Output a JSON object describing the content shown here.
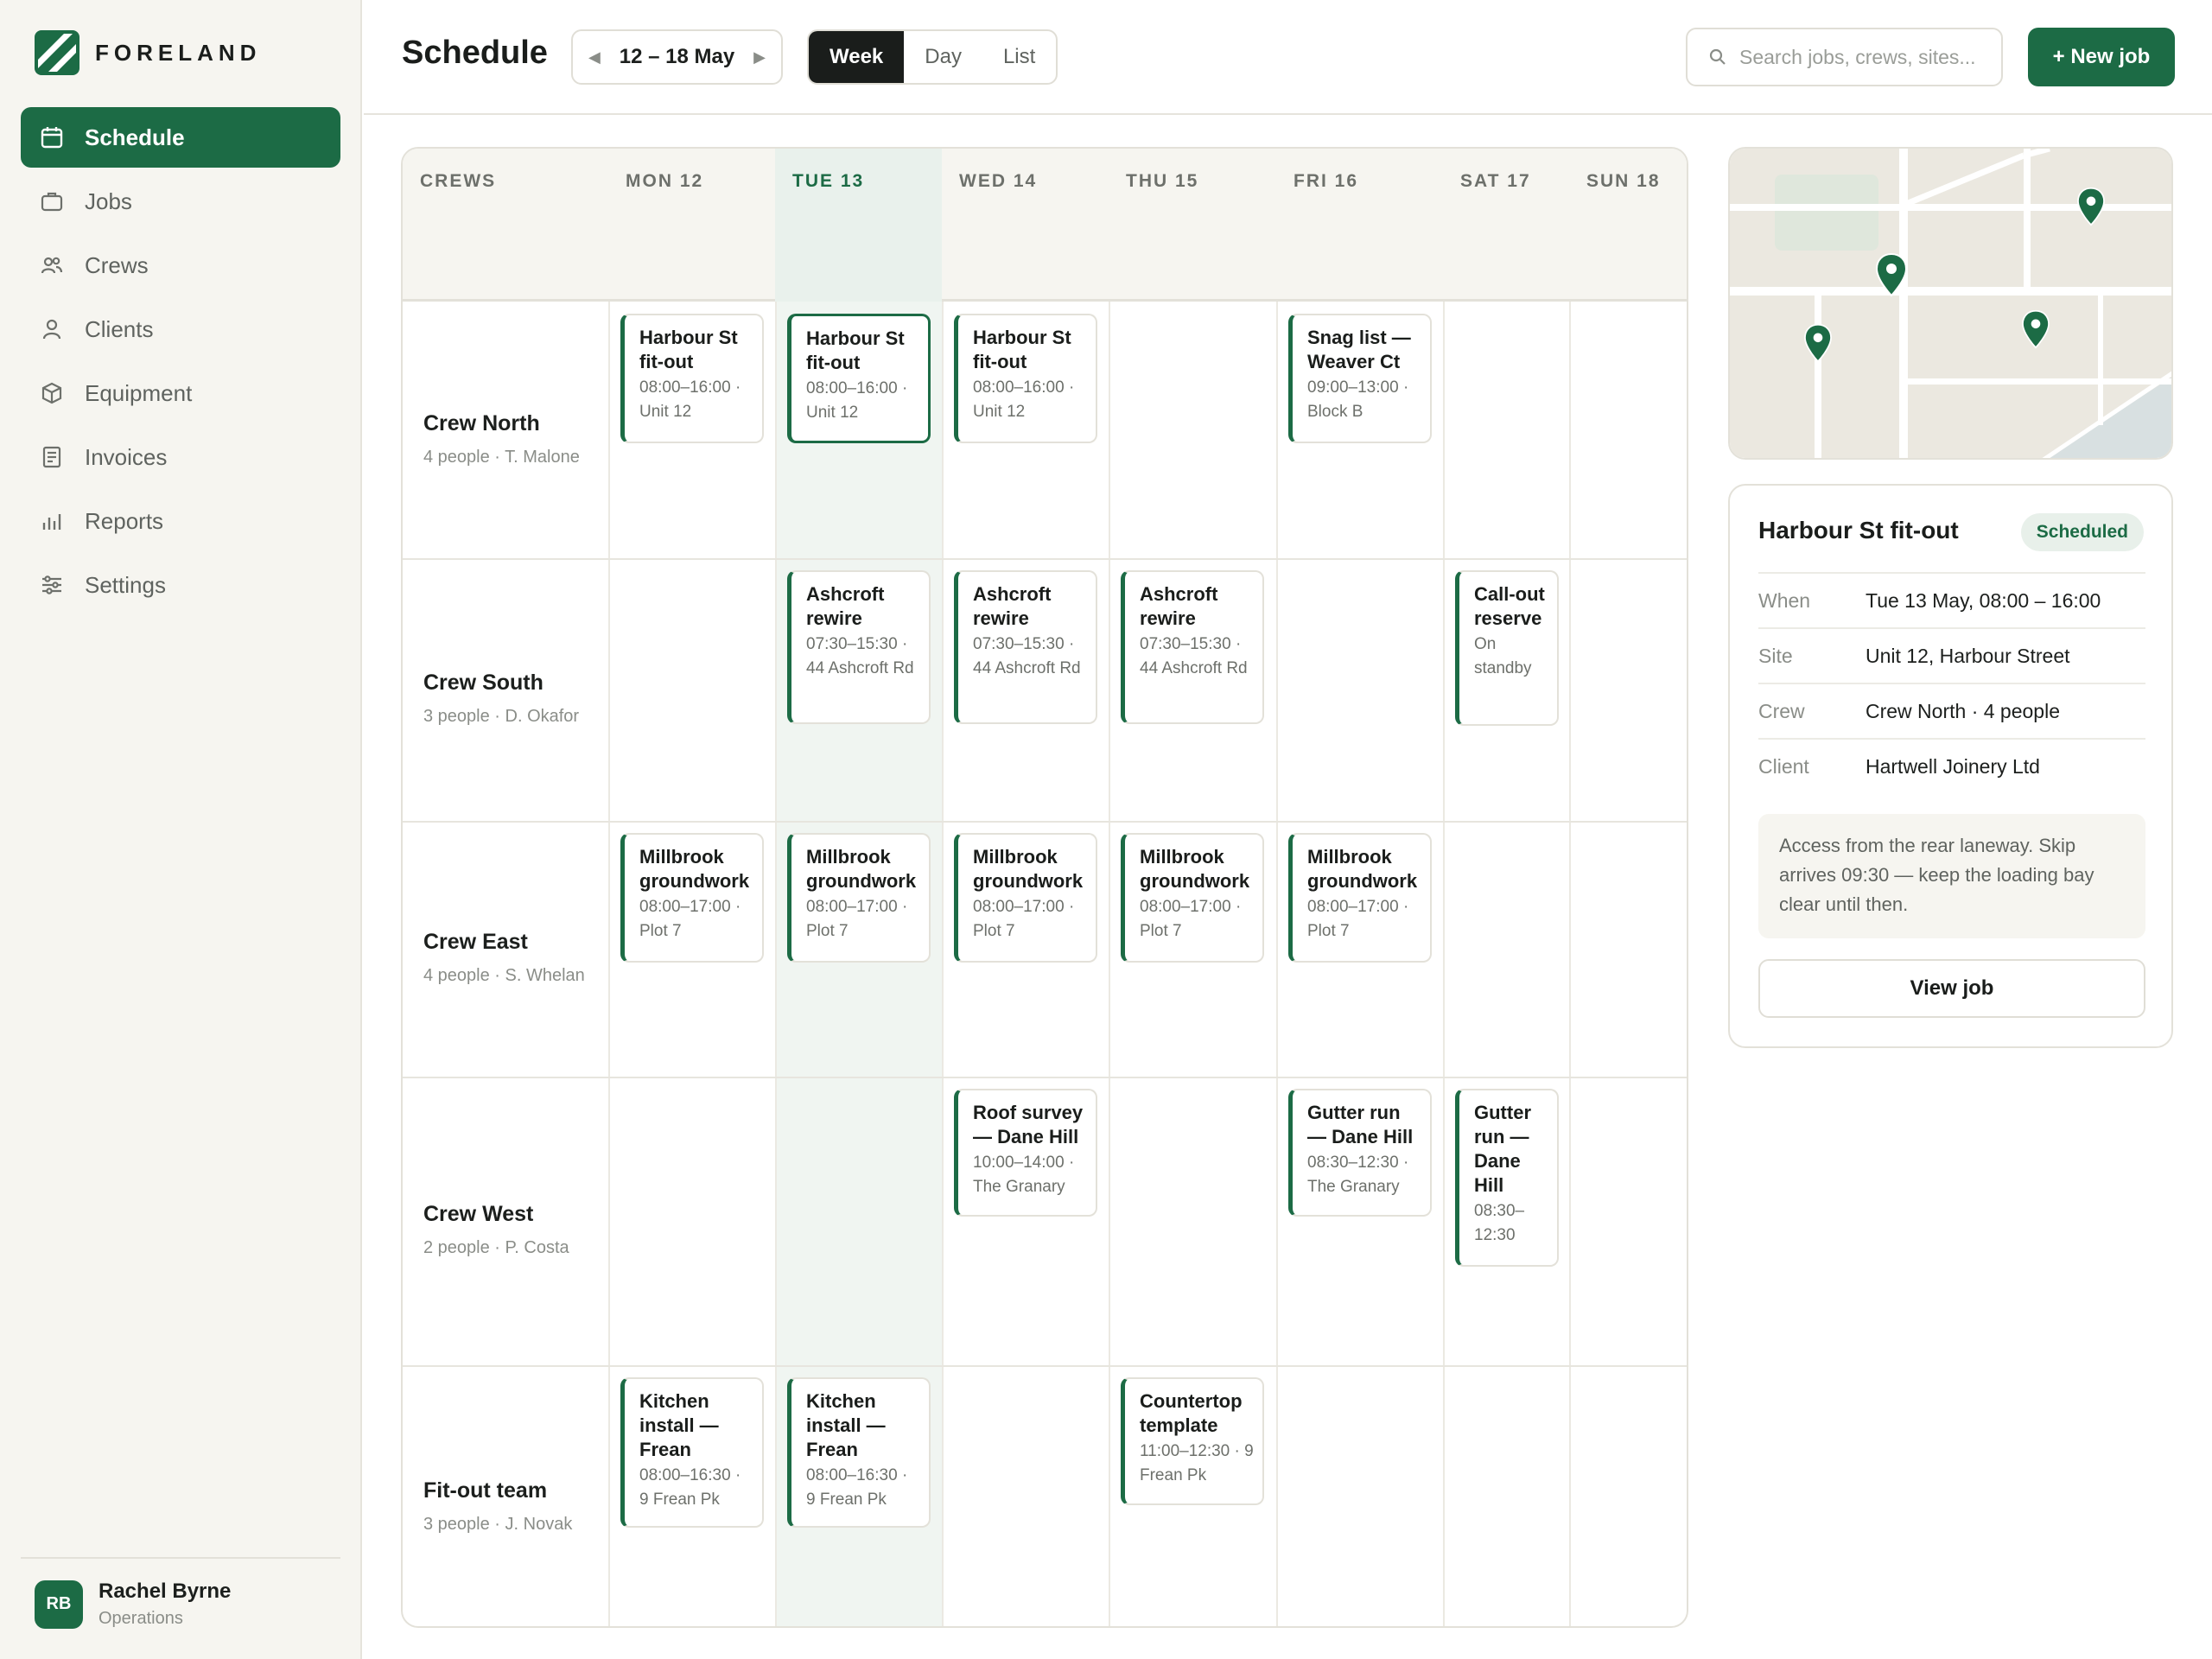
{
  "brand": {
    "name": "FORELAND"
  },
  "nav": [
    {
      "label": "Schedule",
      "icon": "calendar-icon",
      "active": true
    },
    {
      "label": "Jobs",
      "icon": "briefcase-icon"
    },
    {
      "label": "Crews",
      "icon": "users-icon"
    },
    {
      "label": "Clients",
      "icon": "user-icon"
    },
    {
      "label": "Equipment",
      "icon": "box-icon"
    },
    {
      "label": "Invoices",
      "icon": "document-icon"
    },
    {
      "label": "Reports",
      "icon": "bar-chart-icon"
    },
    {
      "label": "Settings",
      "icon": "sliders-icon"
    }
  ],
  "user": {
    "initials": "RB",
    "name": "Rachel Byrne",
    "role": "Operations"
  },
  "header": {
    "title": "Schedule",
    "date_range": "12 – 18 May",
    "views": [
      "Week",
      "Day",
      "List"
    ],
    "active_view": "Week",
    "search_placeholder": "Search jobs, crews, sites...",
    "new_job_label": "+ New job"
  },
  "grid": {
    "crews_header": "CREWS",
    "days": [
      "MON 12",
      "TUE 13",
      "WED 14",
      "THU 15",
      "FRI 16",
      "SAT 17",
      "SUN 18"
    ],
    "today_index": 1,
    "crews": [
      {
        "name": "Crew North",
        "meta": "4 people · T. Malone"
      },
      {
        "name": "Crew South",
        "meta": "3 people · D. Okafor"
      },
      {
        "name": "Crew East",
        "meta": "4 people · S. Whelan"
      },
      {
        "name": "Crew West",
        "meta": "2 people · P. Costa"
      },
      {
        "name": "Fit-out team",
        "meta": "3 people · J. Novak"
      }
    ],
    "jobs": [
      {
        "crew": 0,
        "day": 0,
        "title": "Harbour St fit-out",
        "meta": "08:00–16:00 · Unit 12"
      },
      {
        "crew": 0,
        "day": 1,
        "title": "Harbour St fit-out",
        "meta": "08:00–16:00 · Unit 12",
        "selected": true
      },
      {
        "crew": 0,
        "day": 2,
        "title": "Harbour St fit-out",
        "meta": "08:00–16:00 · Unit 12"
      },
      {
        "crew": 0,
        "day": 4,
        "title": "Snag list — Weaver Ct",
        "meta": "09:00–13:00 · Block B"
      },
      {
        "crew": 1,
        "day": 1,
        "title": "Ashcroft rewire",
        "meta": "07:30–15:30 · 44 Ashcroft Rd"
      },
      {
        "crew": 1,
        "day": 2,
        "title": "Ashcroft rewire",
        "meta": "07:30–15:30 · 44 Ashcroft Rd"
      },
      {
        "crew": 1,
        "day": 3,
        "title": "Ashcroft rewire",
        "meta": "07:30–15:30 · 44 Ashcroft Rd"
      },
      {
        "crew": 1,
        "day": 5,
        "title": "Call-out reserve",
        "meta": "On standby"
      },
      {
        "crew": 2,
        "day": 0,
        "title": "Millbrook groundwork",
        "meta": "08:00–17:00 · Plot 7"
      },
      {
        "crew": 2,
        "day": 1,
        "title": "Millbrook groundwork",
        "meta": "08:00–17:00 · Plot 7"
      },
      {
        "crew": 2,
        "day": 2,
        "title": "Millbrook groundwork",
        "meta": "08:00–17:00 · Plot 7"
      },
      {
        "crew": 2,
        "day": 3,
        "title": "Millbrook groundwork",
        "meta": "08:00–17:00 · Plot 7"
      },
      {
        "crew": 2,
        "day": 4,
        "title": "Millbrook groundwork",
        "meta": "08:00–17:00 · Plot 7"
      },
      {
        "crew": 3,
        "day": 2,
        "title": "Roof survey — Dane Hill",
        "meta": "10:00–14:00 · The Granary"
      },
      {
        "crew": 3,
        "day": 4,
        "title": "Gutter run — Dane Hill",
        "meta": "08:30–12:30 · The Granary"
      },
      {
        "crew": 3,
        "day": 5,
        "title": "Gutter run — Dane Hill",
        "meta": "08:30–12:30"
      },
      {
        "crew": 4,
        "day": 0,
        "title": "Kitchen install — Frean",
        "meta": "08:00–16:30 · 9 Frean Pk"
      },
      {
        "crew": 4,
        "day": 1,
        "title": "Kitchen install — Frean",
        "meta": "08:00–16:30 · 9 Frean Pk"
      },
      {
        "crew": 4,
        "day": 3,
        "title": "Countertop template",
        "meta": "11:00–12:30 · 9 Frean Pk"
      }
    ]
  },
  "detail": {
    "title": "Harbour St fit-out",
    "status": "Scheduled",
    "rows": [
      {
        "label": "When",
        "value": "Tue 13 May, 08:00 – 16:00"
      },
      {
        "label": "Site",
        "value": "Unit 12, Harbour Street"
      },
      {
        "label": "Crew",
        "value": "Crew North · 4 people"
      },
      {
        "label": "Client",
        "value": "Hartwell Joinery Ltd"
      }
    ],
    "note": "Access from the rear laneway. Skip arrives 09:30 — keep the loading bay clear until then.",
    "button_label": "View job"
  },
  "colors": {
    "accent": "#1c6b45",
    "sidebar_bg": "#f6f5f0",
    "today_band": "#f0f5f1"
  }
}
